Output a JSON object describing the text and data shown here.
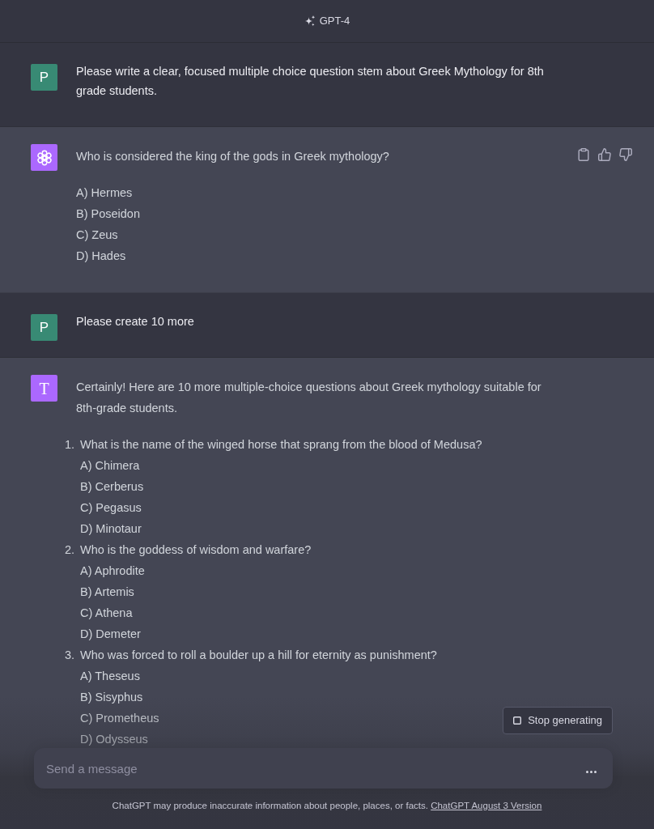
{
  "header": {
    "model": "GPT-4"
  },
  "messages": [
    {
      "kind": "user",
      "avatar": {
        "kind": "initial",
        "letter": "P"
      },
      "feedback_buttons": false,
      "blocks": [
        {
          "kind": "paragraph",
          "text": "Please write a clear, focused multiple choice question stem about Greek Mythology for 8th grade students."
        }
      ]
    },
    {
      "kind": "assistant",
      "avatar": {
        "kind": "logo"
      },
      "feedback_buttons": true,
      "blocks": [
        {
          "kind": "paragraph",
          "text": "Who is considered the king of the gods in Greek mythology?"
        },
        {
          "kind": "lines",
          "lines": [
            "A) Hermes",
            "B) Poseidon",
            "C) Zeus",
            "D) Hades"
          ]
        }
      ]
    },
    {
      "kind": "user",
      "avatar": {
        "kind": "initial",
        "letter": "P"
      },
      "feedback_buttons": false,
      "blocks": [
        {
          "kind": "paragraph",
          "text": "Please create 10 more"
        }
      ]
    },
    {
      "kind": "assistant",
      "avatar": {
        "kind": "serif_initial",
        "letter": "T"
      },
      "feedback_buttons": false,
      "blocks": [
        {
          "kind": "paragraph",
          "text": "Certainly! Here are 10 more multiple-choice questions about Greek mythology suitable for 8th-grade students."
        },
        {
          "kind": "numbered_list",
          "items": [
            {
              "number": "1.",
              "question": "What is the name of the winged horse that sprang from the blood of Medusa?",
              "options": [
                "A) Chimera",
                "B) Cerberus",
                "C) Pegasus",
                "D) Minotaur"
              ]
            },
            {
              "number": "2.",
              "question": "Who is the goddess of wisdom and warfare?",
              "options": [
                "A) Aphrodite",
                "B) Artemis",
                "C) Athena",
                "D) Demeter"
              ]
            },
            {
              "number": "3.",
              "question": "Who was forced to roll a boulder up a hill for eternity as punishment?",
              "options": [
                "A) Theseus",
                "B) Sisyphus",
                "C) Prometheus",
                "D) Odysseus"
              ]
            }
          ]
        }
      ]
    }
  ],
  "stop_button": {
    "label": "Stop generating"
  },
  "composer": {
    "placeholder": "Send a message",
    "generating": true
  },
  "footer": {
    "notice": "ChatGPT may produce inaccurate information about people, places, or facts.",
    "link": "ChatGPT August 3 Version"
  }
}
